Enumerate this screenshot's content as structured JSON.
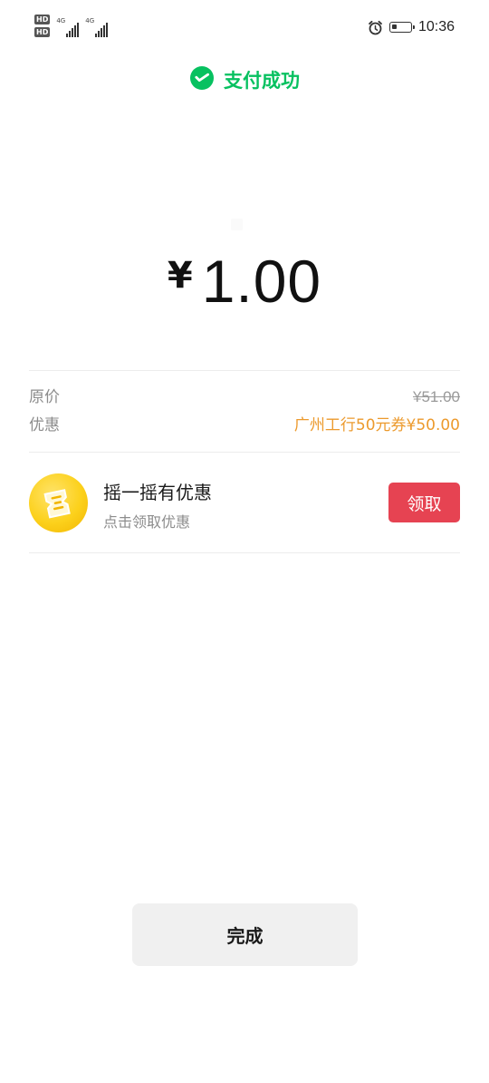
{
  "status_bar": {
    "hd_badges": [
      "HD",
      "HD"
    ],
    "network_labels": [
      "4G",
      "4G"
    ],
    "time": "10:36",
    "battery_level": 0.3,
    "icons": [
      "alarm-icon",
      "battery-icon"
    ]
  },
  "header": {
    "title": "支付成功",
    "icon": "wechat-pay-icon",
    "accent_color": "#07c160"
  },
  "amount": {
    "currency": "¥",
    "value": "1.00"
  },
  "details": {
    "original_price_label": "原价",
    "original_price_value": "¥51.00",
    "discount_label": "优惠",
    "discount_value": "广州工行50元券¥50.00",
    "discount_color": "#ec9a2d"
  },
  "promo": {
    "icon": "shake-coupon-icon",
    "title": "摇一摇有优惠",
    "subtitle": "点击领取优惠",
    "button_label": "领取",
    "button_color": "#e64352"
  },
  "footer": {
    "done_label": "完成"
  }
}
